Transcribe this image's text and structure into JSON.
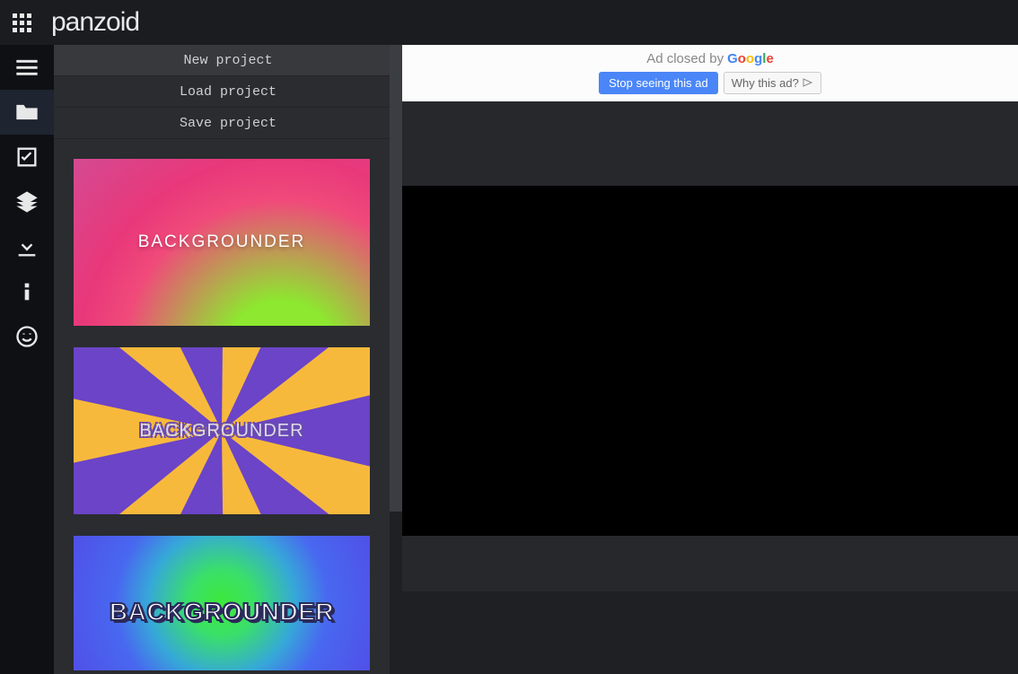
{
  "brand": "panzoid",
  "menu": {
    "new": "New project",
    "load": "Load project",
    "save": "Save project"
  },
  "templates": {
    "t1": "BACKGROUNDER",
    "t2": "BACKGROUNDER",
    "t3": "BACKGROUNDER"
  },
  "ad": {
    "closed_prefix": "Ad closed by",
    "stop": "Stop seeing this ad",
    "why": "Why this ad?"
  }
}
